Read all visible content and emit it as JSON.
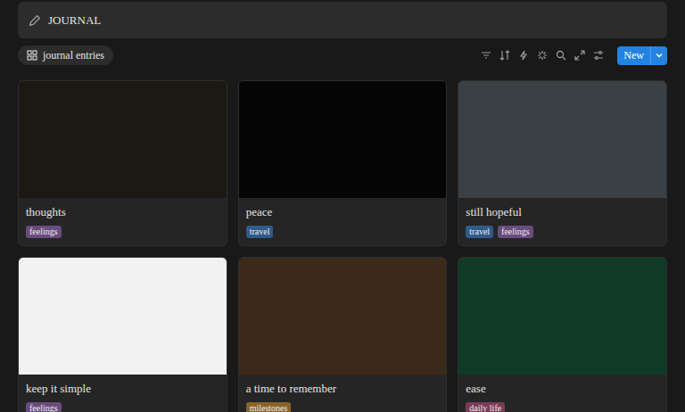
{
  "header": {
    "title": "JOURNAL"
  },
  "view": {
    "label": "journal entries",
    "selected": true
  },
  "toolbar": {
    "new_button": "New"
  },
  "cards": [
    {
      "title": "thoughts",
      "cover": {
        "color": "#1c1814"
      },
      "tags": [
        {
          "label": "feelings",
          "color": "#6a4b7d"
        }
      ]
    },
    {
      "title": "peace",
      "cover": {
        "color": "#050505"
      },
      "tags": [
        {
          "label": "travel",
          "color": "#2f5b8a"
        }
      ]
    },
    {
      "title": "still hopeful",
      "cover": {
        "color": "#3a4043"
      },
      "tags": [
        {
          "label": "travel",
          "color": "#2f5b8a"
        },
        {
          "label": "feelings",
          "color": "#6a4b7d"
        }
      ]
    },
    {
      "title": "keep it simple",
      "cover": {
        "color": "#f2f2f2"
      },
      "tags": [
        {
          "label": "feelings",
          "color": "#6a4b7d"
        }
      ]
    },
    {
      "title": "a time to remember",
      "cover": {
        "color": "#3b2a1a"
      },
      "tags": [
        {
          "label": "milestones",
          "color": "#89632a"
        }
      ]
    },
    {
      "title": "ease",
      "cover": {
        "color": "#0f3a26"
      },
      "tags": [
        {
          "label": "daily life",
          "color": "#7a3b55"
        }
      ]
    }
  ]
}
